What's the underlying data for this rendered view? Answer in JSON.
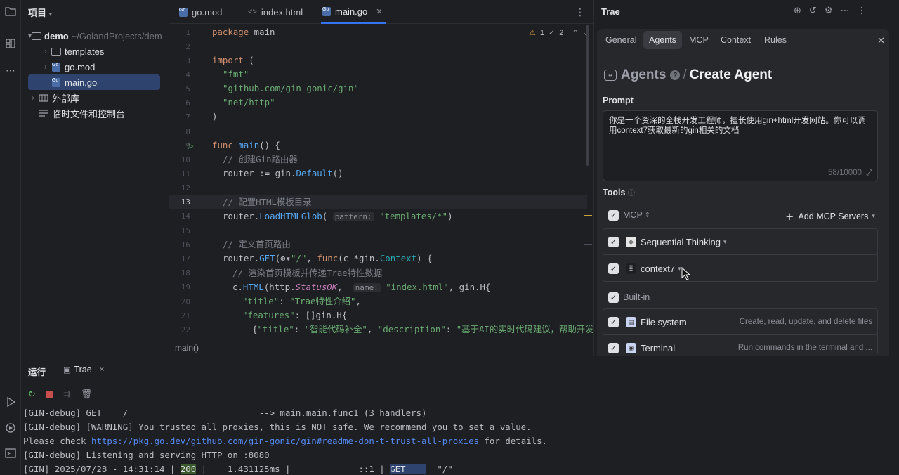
{
  "project_panel": {
    "title": "项目",
    "tree": [
      {
        "label": "demo",
        "path": "~/GolandProjects/dem"
      },
      {
        "label": "templates"
      },
      {
        "label": "go.mod"
      },
      {
        "label": "main.go"
      },
      {
        "label": "外部库"
      },
      {
        "label": "临时文件和控制台"
      }
    ]
  },
  "editor": {
    "tabs": [
      "go.mod",
      "index.html",
      "main.go"
    ],
    "inspections": {
      "warnings": "1",
      "weak": "2"
    },
    "line_numbers": [
      "1",
      "2",
      "3",
      "4",
      "5",
      "6",
      "7",
      "8",
      "9",
      "10",
      "11",
      "12",
      "13",
      "14",
      "15",
      "16",
      "17",
      "18",
      "19",
      "20",
      "21",
      "22"
    ],
    "code": {
      "l1_kw": "package",
      "l1_rest": " main",
      "l3_kw": "import",
      "l3_rest": " (",
      "l4": "\"fmt\"",
      "l5": "\"github.com/gin-gonic/gin\"",
      "l6": "\"net/http\"",
      "l7": ")",
      "l9_kw": "func",
      "l9_fn": "main",
      "l9_rest": "() {",
      "l10": "// 创建Gin路由器",
      "l11_a": "router := gin.",
      "l11_fn": "Default",
      "l11_b": "()",
      "l13": "// 配置HTML模板目录",
      "l14_a": "router.",
      "l14_fn": "LoadHTMLGlob",
      "l14_b": "(",
      "l14_hint": "pattern:",
      "l14_str": "\"templates/*\"",
      "l14_c": ")",
      "l16": "// 定义首页路由",
      "l17_a": "router.",
      "l17_fn": "GET",
      "l17_b": "(⊕▾",
      "l17_str": "\"/\"",
      "l17_c": ", ",
      "l17_kw": "func",
      "l17_d": "(c *gin.",
      "l17_ty": "Context",
      "l17_e": ") {",
      "l18": "// 渲染首页模板并传递Trae特性数据",
      "l19_a": "c.",
      "l19_fn": "HTML",
      "l19_b": "(http.",
      "l19_it": "StatusOK",
      "l19_c": ", ",
      "l19_hint": "name:",
      "l19_str": "\"index.html\"",
      "l19_d": ", gin.H{",
      "l20_k": "\"title\"",
      "l20_a": ": ",
      "l20_v": "\"Trae特性介绍\"",
      "l20_b": ",",
      "l21_k": "\"features\"",
      "l21_a": ": []gin.H{",
      "l22_a": "{",
      "l22_k1": "\"title\"",
      "l22_b": ": ",
      "l22_v1": "\"智能代码补全\"",
      "l22_c": ", ",
      "l22_k2": "\"description\"",
      "l22_d": ": ",
      "l22_v2": "\"基于AI的实时代码建议，帮助开发者快"
    },
    "breadcrumb": "main()"
  },
  "trae": {
    "title": "Trae",
    "tabs": [
      "General",
      "Agents",
      "MCP",
      "Context",
      "Rules"
    ],
    "breadcrumb_parent": "Agents",
    "breadcrumb_sep": "/",
    "page_title": "Create Agent",
    "prompt_label": "Prompt",
    "prompt_text": "你是一个资深的全栈开发工程师，擅长使用gin+html开发网站。你可以调用context7获取最新的gin相关的文档",
    "prompt_count": "58/10000",
    "tools_label": "Tools",
    "mcp_label": "MCP",
    "add_mcp": "Add MCP Servers",
    "mcp_servers": [
      "Sequential Thinking",
      "context7"
    ],
    "builtin_label": "Built-in",
    "builtin_tools": [
      {
        "name": "File system",
        "desc": "Create, read, update, and delete files"
      },
      {
        "name": "Terminal",
        "desc": "Run commands in the terminal and ..."
      }
    ]
  },
  "run_panel": {
    "label": "运行",
    "tab": "Trae",
    "lines": {
      "l1": "[GIN-debug] GET    /                         --> main.main.func1 (3 handlers)",
      "l2": "[GIN-debug] [WARNING] You trusted all proxies, this is NOT safe. We recommend you to set a value.",
      "l3_a": "Please check ",
      "l3_link": "https://pkg.go.dev/github.com/gin-gonic/gin#readme-don-t-trust-all-proxies",
      "l3_b": " for details.",
      "l4": "[GIN-debug] Listening and serving HTTP on :8080",
      "l5_a": "[GIN] 2025/07/28 - 14:31:14 | ",
      "l5_status": "200",
      "l5_b": " |    1.431125ms |             ::1 | ",
      "l5_method": "GET    ",
      "l5_c": "  \"/\""
    }
  }
}
